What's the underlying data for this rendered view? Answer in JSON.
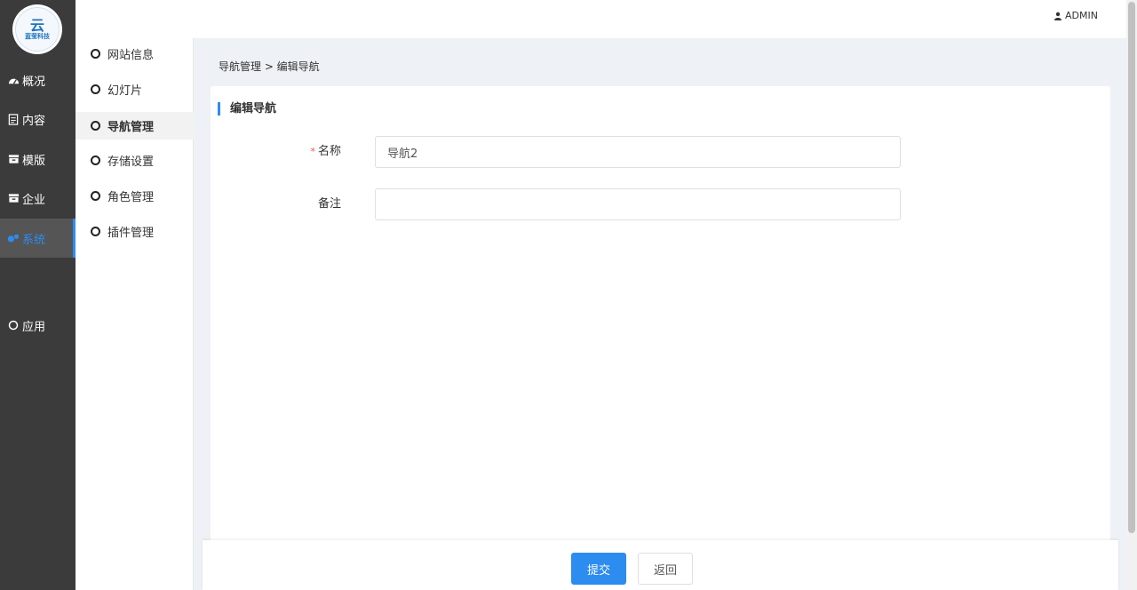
{
  "app": {
    "logo_mark": "云",
    "logo_text": "蓝莹科技"
  },
  "header": {
    "user_label": "ADMIN"
  },
  "sidebar": {
    "items": [
      {
        "label": "概况",
        "icon": "dashboard-icon"
      },
      {
        "label": "内容",
        "icon": "document-icon"
      },
      {
        "label": "模版",
        "icon": "template-icon"
      },
      {
        "label": "企业",
        "icon": "enterprise-icon"
      },
      {
        "label": "系统",
        "icon": "gears-icon",
        "active": true
      },
      {
        "label": "应用",
        "icon": "circle-icon"
      }
    ]
  },
  "submenu": {
    "items": [
      {
        "label": "网站信息"
      },
      {
        "label": "幻灯片"
      },
      {
        "label": "导航管理",
        "active": true
      },
      {
        "label": "存储设置"
      },
      {
        "label": "角色管理"
      },
      {
        "label": "插件管理"
      }
    ]
  },
  "breadcrumb": {
    "text": "导航管理 > 编辑导航"
  },
  "form": {
    "title": "编辑导航",
    "fields": [
      {
        "label": "名称",
        "required_mark": "*",
        "value": "导航2",
        "placeholder": ""
      },
      {
        "label": "备注",
        "required_mark": "",
        "value": "",
        "placeholder": ""
      }
    ]
  },
  "footer": {
    "submit_label": "提交",
    "back_label": "返回"
  },
  "colors": {
    "accent": "#2d8cf0",
    "sidebar_bg": "#3b3b3b",
    "required": "#ff4d4f"
  }
}
